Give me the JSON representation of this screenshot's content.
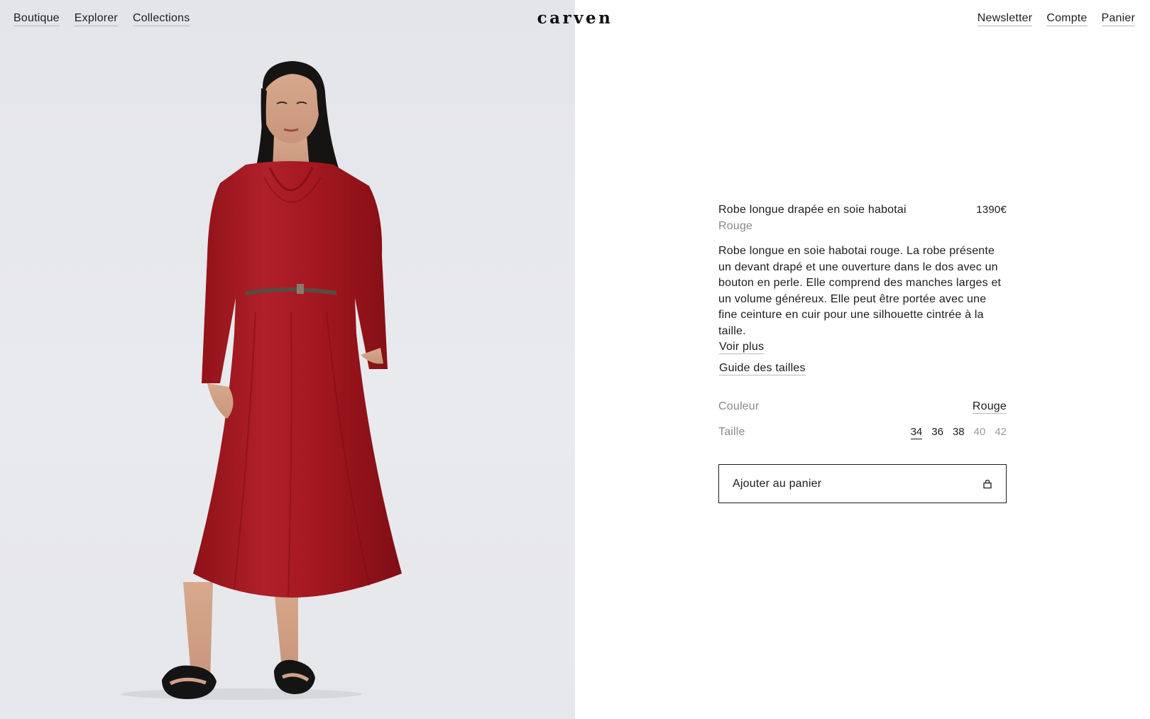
{
  "header": {
    "nav_left": [
      "Boutique",
      "Explorer",
      "Collections"
    ],
    "logo": "carven",
    "nav_right": [
      "Newsletter",
      "Compte",
      "Panier"
    ]
  },
  "hero": {
    "icon": "model-photo-red-dress"
  },
  "product": {
    "name": "Robe longue drapée en soie habotai",
    "price": "1390€",
    "color_subtitle": "Rouge",
    "description": "Robe longue en soie habotai rouge. La robe présente un devant drapé et une ouverture dans le dos avec un bouton en perle. Elle comprend des manches larges et un volume généreux. Elle peut être portée avec une fine ceinture en cuir pour une silhouette cintrée à la taille.",
    "voir_plus": "Voir plus",
    "size_guide": "Guide des tailles",
    "color_label": "Couleur",
    "color_value": "Rouge",
    "size_label": "Taille",
    "sizes": [
      {
        "label": "34",
        "state": "selected"
      },
      {
        "label": "36",
        "state": "available"
      },
      {
        "label": "38",
        "state": "available"
      },
      {
        "label": "40",
        "state": "unavailable"
      },
      {
        "label": "42",
        "state": "unavailable"
      }
    ],
    "add_to_cart": "Ajouter au panier",
    "add_to_cart_icon": "shopping-bag-icon"
  },
  "colors": {
    "dress": "#a5191f",
    "background_left": "#e6e7eb",
    "text": "#1c1c1c",
    "muted": "#8a8a8a"
  }
}
